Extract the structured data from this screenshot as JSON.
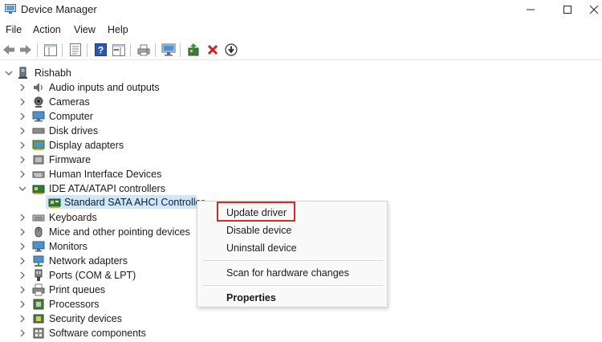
{
  "window": {
    "title": "Device Manager"
  },
  "menubar": {
    "items": [
      "File",
      "Action",
      "View",
      "Help"
    ]
  },
  "tree": {
    "root": "Rishabh",
    "categories": [
      "Audio inputs and outputs",
      "Cameras",
      "Computer",
      "Disk drives",
      "Display adapters",
      "Firmware",
      "Human Interface Devices",
      "IDE ATA/ATAPI controllers",
      "Keyboards",
      "Mice and other pointing devices",
      "Monitors",
      "Network adapters",
      "Ports (COM & LPT)",
      "Print queues",
      "Processors",
      "Security devices",
      "Software components"
    ],
    "selected_device": "Standard SATA AHCI Controller"
  },
  "context_menu": {
    "update": "Update driver",
    "disable": "Disable device",
    "uninstall": "Uninstall device",
    "scan": "Scan for hardware changes",
    "properties": "Properties"
  },
  "colors": {
    "highlight_border": "#d42a2a",
    "selection": "#cce8ff"
  }
}
